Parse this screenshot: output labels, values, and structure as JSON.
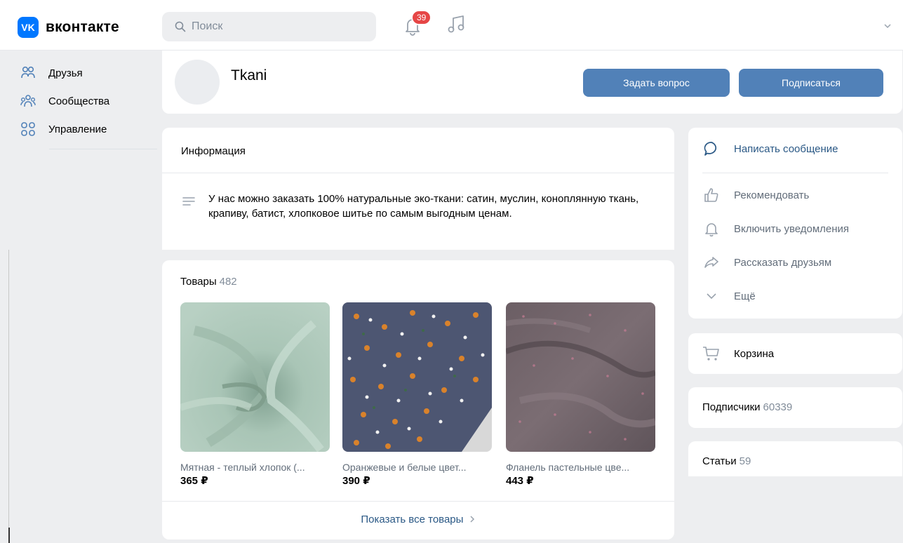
{
  "header": {
    "logo_mark": "VK",
    "logo_text": "вконтакте",
    "search_placeholder": "Поиск",
    "notifications_count": "39"
  },
  "sidebar": {
    "items": [
      {
        "label": "Друзья",
        "icon": "friends-icon"
      },
      {
        "label": "Сообщества",
        "icon": "communities-icon"
      },
      {
        "label": "Управление",
        "icon": "manage-icon"
      }
    ]
  },
  "group": {
    "name": "Tkani",
    "ask_button": "Задать вопрос",
    "subscribe_button": "Подписаться"
  },
  "info": {
    "title": "Информация",
    "text": "У нас можно заказать 100% натуральные эко-ткани: сатин, муслин, коноплянную ткань, крапиву, батист, хлопковое шитье по самым выгодным ценам."
  },
  "goods": {
    "title": "Товары",
    "count": "482",
    "items": [
      {
        "name": "Мятная - теплый хлопок (...",
        "price": "365 ₽",
        "color": "#a8c3b4"
      },
      {
        "name": "Оранжевые и белые цвет...",
        "price": "390 ₽",
        "color": "#4b5570"
      },
      {
        "name": "Фланель пастельные цве...",
        "price": "443 ₽",
        "color": "#6f6268"
      }
    ],
    "show_all": "Показать все товары"
  },
  "actions": {
    "message": "Написать сообщение",
    "recommend": "Рекомендовать",
    "notify": "Включить уведомления",
    "share": "Рассказать друзьям",
    "more": "Ещё"
  },
  "cart": {
    "label": "Корзина"
  },
  "subscribers": {
    "label": "Подписчики",
    "count": "60339"
  },
  "articles": {
    "label": "Статьи",
    "count": "59"
  },
  "colors": {
    "accent": "#5181b8",
    "link": "#2a5885",
    "badge": "#e64646",
    "icon": "#99a2ad",
    "vk_blue": "#0077ff"
  }
}
